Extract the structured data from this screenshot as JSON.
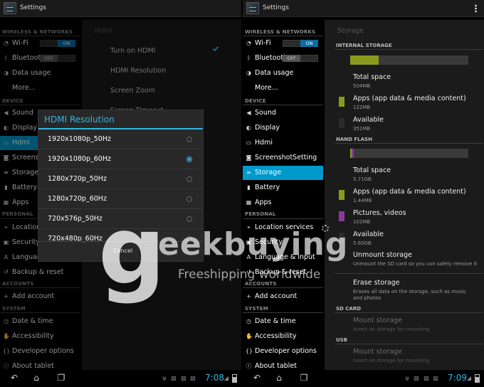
{
  "app_title": "Settings",
  "sidebar": {
    "wireless": "WIRELESS & NETWORKS",
    "device": "DEVICE",
    "personal": "PERSONAL",
    "accounts": "ACCOUNTS",
    "system": "SYSTEM",
    "wifi": "Wi-Fi",
    "wifi_toggle": "ON",
    "bluetooth": "Bluetooth",
    "bluetooth_toggle": "OFF",
    "data_usage": "Data usage",
    "more": "More...",
    "sound": "Sound",
    "display": "Display",
    "hdmi": "Hdmi",
    "screenshot": "ScreenshotSetting",
    "storage": "Storage",
    "battery": "Battery",
    "apps": "Apps",
    "location": "Location services",
    "security": "Security",
    "language": "Language & input",
    "backup": "Backup & reset",
    "add_account": "Add account",
    "date_time": "Date & time",
    "accessibility": "Accessibility",
    "developer": "Developer options",
    "about": "About tablet"
  },
  "hdmi_panel": {
    "title": "Hdmi",
    "turn_on": "Turn on HDMI",
    "resolution": "HDMI Resolution",
    "screen_zoom": "Screen Zoom",
    "screen_timeout": "Screen Timeout"
  },
  "dialog": {
    "title": "HDMI Resolution",
    "options": [
      "1920x1080p_50Hz",
      "1920x1080p_60Hz",
      "1280x720p_50Hz",
      "1280x720p_60Hz",
      "720x576p_50Hz",
      "720x480p_60Hz"
    ],
    "selected_index": 1,
    "cancel": "Cancel"
  },
  "storage": {
    "title": "Storage",
    "internal": {
      "header": "INTERNAL STORAGE",
      "bar_used_fraction": 0.24,
      "total_label": "Total space",
      "total_value": "504MB",
      "apps_label": "Apps (app data & media content)",
      "apps_value": "122MB",
      "avail_label": "Available",
      "avail_value": "351MB"
    },
    "nand": {
      "header": "NAND FLASH",
      "bar_apps_fraction": 0.01,
      "bar_pics_fraction": 0.02,
      "total_label": "Total space",
      "total_value": "5.71GB",
      "apps_label": "Apps (app data & media content)",
      "apps_value": "1.44MB",
      "pics_label": "Pictures, videos",
      "pics_value": "102MB",
      "avail_label": "Available",
      "avail_value": "5.60GB",
      "unmount_label": "Unmount storage",
      "unmount_sub": "Unmount the SD card so you can safely remove it",
      "erase_label": "Erase storage",
      "erase_sub": "Erases all data on the storage, such as music and photos"
    },
    "sdcard": {
      "header": "SD CARD",
      "mount_label": "Mount storage",
      "mount_sub": "Insert an storage for mounting"
    },
    "usb": {
      "header": "USB",
      "mount_label": "Mount storage",
      "mount_sub": "Insert an storage for mounting"
    }
  },
  "status": {
    "time_left": "7:08",
    "time_right": "7:09"
  },
  "watermark": {
    "brand": "eekbuying",
    "tagline": "Freeshipping worldwide"
  },
  "colors": {
    "accent": "#33b5e5",
    "selected": "#0099cc",
    "apps_swatch": "#8a9a1e",
    "pics_swatch": "#8a3a9a"
  }
}
